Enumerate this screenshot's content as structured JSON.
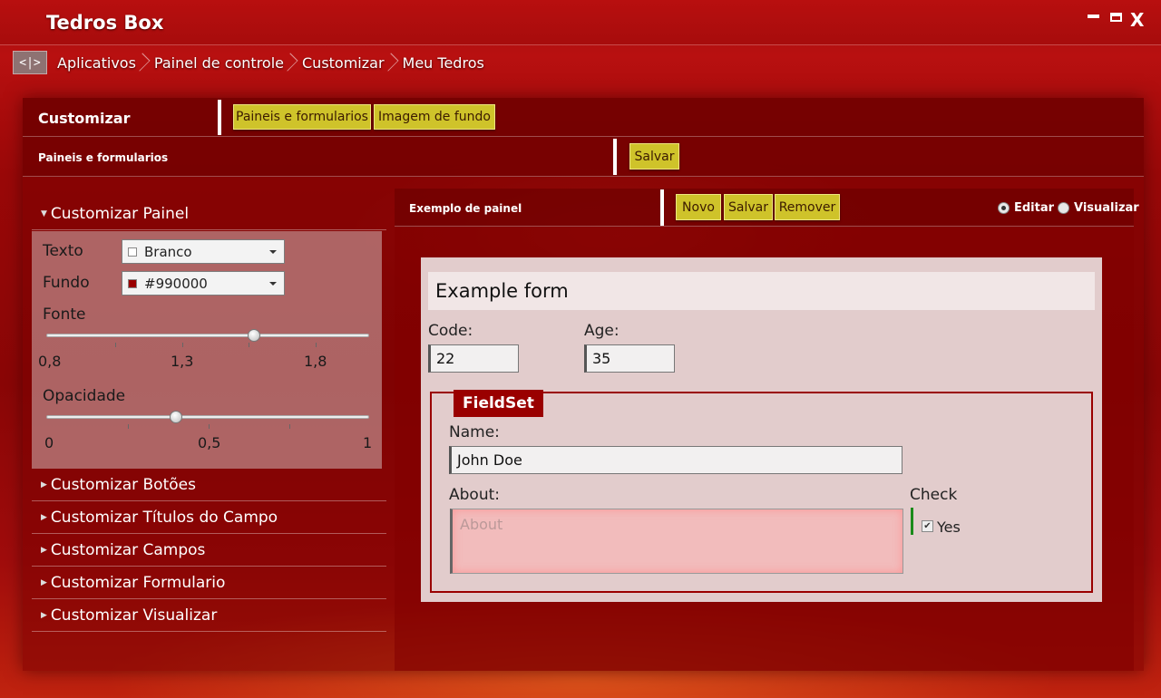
{
  "app": {
    "title": "Tedros Box"
  },
  "window": {
    "close_label": "X"
  },
  "breadcrumb": {
    "toggle": "<|>",
    "items": [
      "Aplicativos",
      "Painel de controle",
      "Customizar",
      "Meu Tedros"
    ]
  },
  "header": {
    "title": "Customizar",
    "tabs": [
      "Paineis e formularios",
      "Imagem de fundo"
    ]
  },
  "subheader": {
    "title": "Paineis e formularios",
    "save_label": "Salvar"
  },
  "accordion": {
    "open_section": {
      "title": "Customizar Painel",
      "texto_label": "Texto",
      "texto_value": "Branco",
      "texto_color": "#ffffff",
      "fundo_label": "Fundo",
      "fundo_value": "#990000",
      "fundo_color": "#990000",
      "fonte_label": "Fonte",
      "fonte_ticks": [
        "0,8",
        "1,3",
        "1,8"
      ],
      "fonte_value": 1.6,
      "opacidade_label": "Opacidade",
      "opacidade_ticks": [
        "0",
        "0,5",
        "1"
      ],
      "opacidade_value": 0.4
    },
    "sections": [
      "Customizar Botões",
      "Customizar Títulos do Campo",
      "Customizar Campos",
      "Customizar Formulario",
      "Customizar Visualizar"
    ]
  },
  "panel": {
    "title": "Exemplo de painel",
    "buttons": {
      "new": "Novo",
      "save": "Salvar",
      "remove": "Remover"
    },
    "modes": {
      "edit": "Editar",
      "view": "Visualizar",
      "selected": "edit"
    }
  },
  "form": {
    "title": "Example form",
    "code_label": "Code:",
    "code_value": "22",
    "age_label": "Age:",
    "age_value": "35",
    "fieldset_legend": "FieldSet",
    "name_label": "Name:",
    "name_value": "John Doe",
    "about_label": "About:",
    "about_placeholder": "About",
    "check_label": "Check",
    "check_option": "Yes",
    "check_checked": true
  },
  "colors": {
    "accent": "#cfc32a",
    "brand": "#990000"
  }
}
